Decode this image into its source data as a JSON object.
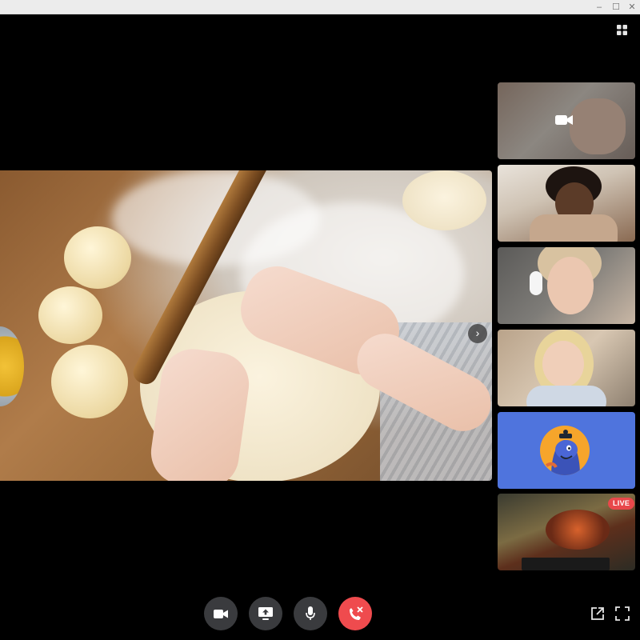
{
  "window": {
    "minimize_glyph": "–",
    "maximize_glyph": "☐",
    "close_glyph": "✕"
  },
  "stage": {
    "next_glyph": "›"
  },
  "participants": [
    {
      "icon": "video-camera-icon",
      "camera_off_overlay": true
    },
    {
      "icon": "participant-video"
    },
    {
      "icon": "participant-video"
    },
    {
      "icon": "participant-video"
    },
    {
      "icon": "bot-avatar-icon",
      "color": "#4f74dd"
    },
    {
      "icon": "game-stream",
      "badge": "LIVE"
    }
  ],
  "controls": {
    "buttons": [
      {
        "icon": "camera-icon"
      },
      {
        "icon": "screen-share-icon"
      },
      {
        "icon": "microphone-icon"
      },
      {
        "icon": "end-call-icon",
        "color": "#ef4b4e"
      }
    ]
  },
  "colors": {
    "background": "#000000",
    "control_bg": "#3a3b3e",
    "live_badge": "#e8484b"
  }
}
